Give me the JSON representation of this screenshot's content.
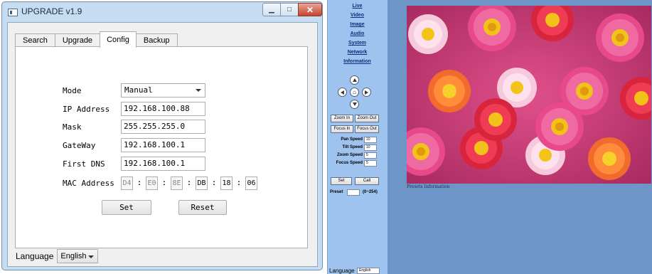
{
  "upgrade_window": {
    "title": "UPGRADE v1.9",
    "tabs": [
      {
        "label": "Search"
      },
      {
        "label": "Upgrade"
      },
      {
        "label": "Config"
      },
      {
        "label": "Backup"
      }
    ],
    "active_tab": "Config",
    "form": {
      "mode_label": "Mode",
      "mode_value": "Manual",
      "ip_label": "IP Address",
      "ip_value": "192.168.100.88",
      "mask_label": "Mask",
      "mask_value": "255.255.255.0",
      "gateway_label": "GateWay",
      "gateway_value": "192.168.100.1",
      "dns_label": "First DNS",
      "dns_value": "192.168.100.1",
      "mac_label": "MAC Address",
      "mac_octets": [
        "D4",
        "E0",
        "8E",
        "DB",
        "18",
        "06"
      ],
      "mac_separator": ":"
    },
    "buttons": {
      "set": "Set",
      "reset": "Reset"
    },
    "language_label": "Language",
    "language_value": "English"
  },
  "web_ui": {
    "nav": [
      "Live",
      "Video",
      "Image",
      "Audio",
      "System",
      "Network",
      "Information"
    ],
    "ptz_buttons": {
      "zoom_in": "Zoom In",
      "zoom_out": "Zoom Out",
      "focus_in": "Focus In",
      "focus_out": "Focus Out"
    },
    "speeds": [
      {
        "label": "Pan Speed",
        "value": "10"
      },
      {
        "label": "Tilt Speed",
        "value": "10"
      },
      {
        "label": "Zoom Speed",
        "value": "5"
      },
      {
        "label": "Focus Speed",
        "value": "5"
      }
    ],
    "preset_buttons": {
      "set": "Set",
      "call": "Call"
    },
    "preset_label": "Preset",
    "preset_range": "(0~254)",
    "presets_information": "Presets Information",
    "language_label": "Language",
    "language_value": "English",
    "colors": {
      "sidebar": "#9fc3ef",
      "background": "#6e95c8"
    }
  }
}
